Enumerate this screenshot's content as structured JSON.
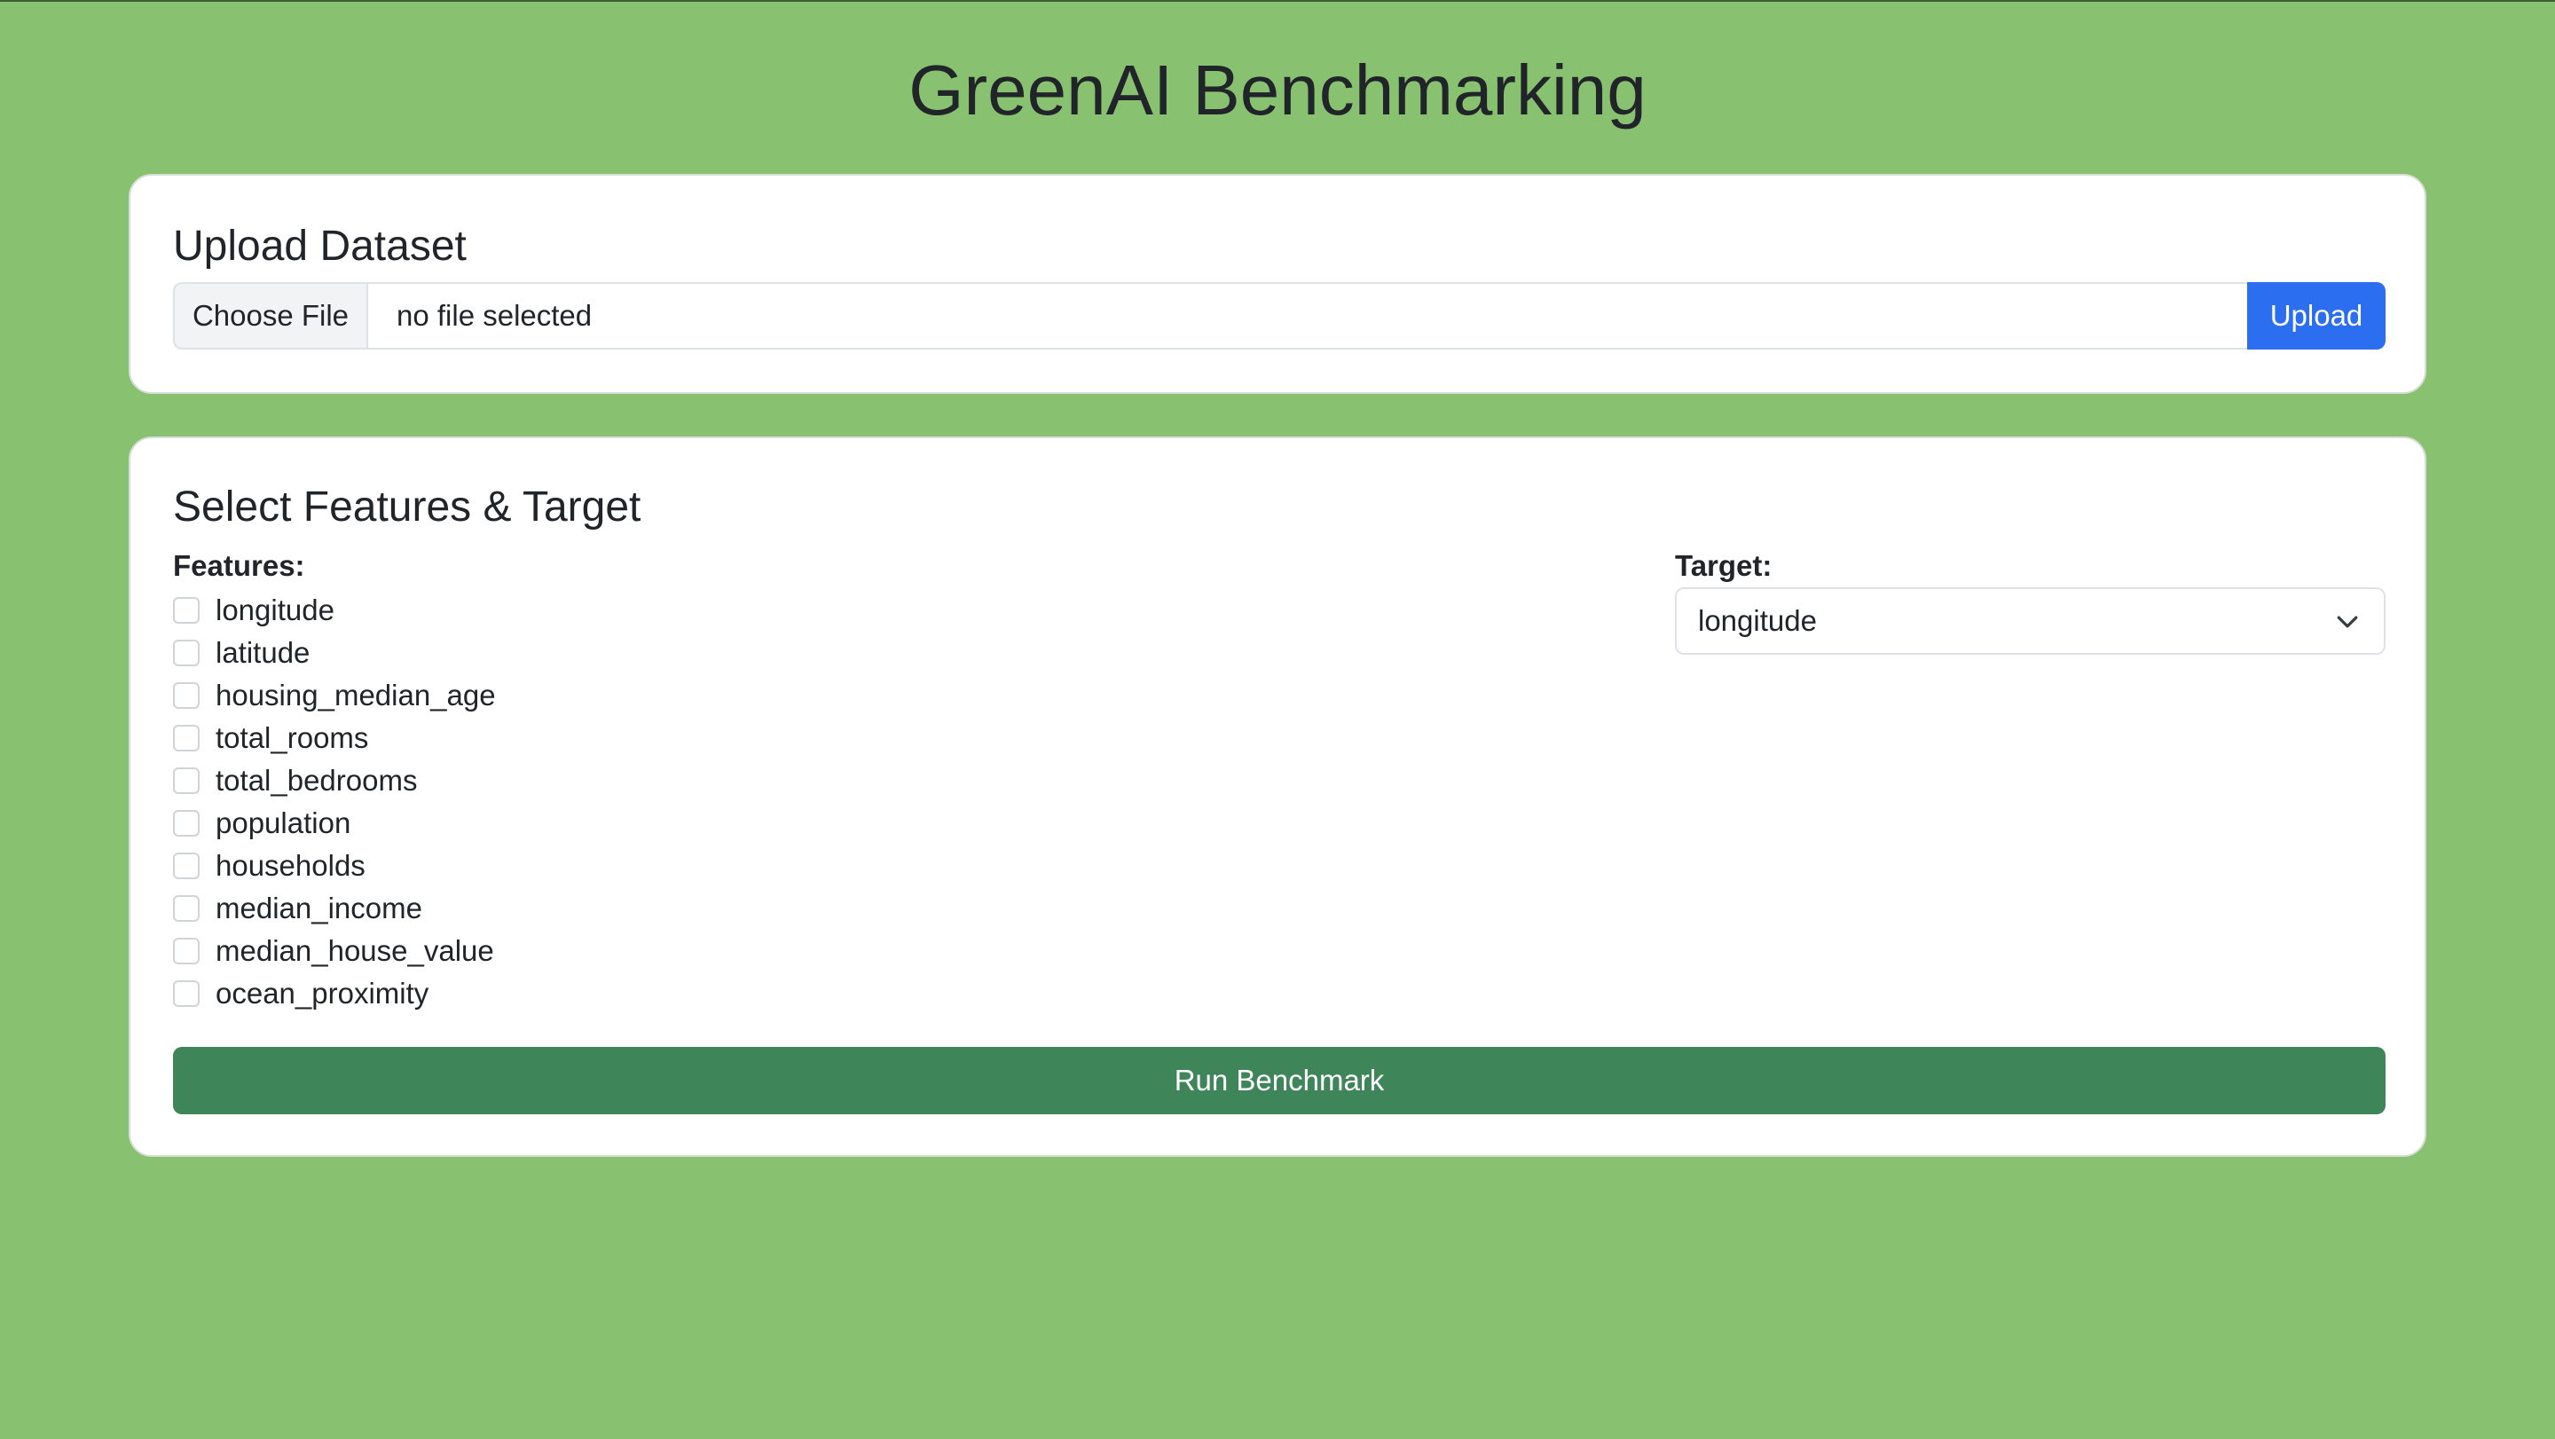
{
  "page": {
    "title": "GreenAI Benchmarking",
    "background_color": "#88c270"
  },
  "upload": {
    "title": "Upload Dataset",
    "choose_file_label": "Choose File",
    "file_status": "no file selected",
    "upload_label": "Upload",
    "upload_color": "#2b6ff0"
  },
  "selection": {
    "title": "Select Features & Target",
    "features_label": "Features:",
    "target_label": "Target:",
    "features": [
      {
        "label": "longitude",
        "checked": false
      },
      {
        "label": "latitude",
        "checked": false
      },
      {
        "label": "housing_median_age",
        "checked": false
      },
      {
        "label": "total_rooms",
        "checked": false
      },
      {
        "label": "total_bedrooms",
        "checked": false
      },
      {
        "label": "population",
        "checked": false
      },
      {
        "label": "households",
        "checked": false
      },
      {
        "label": "median_income",
        "checked": false
      },
      {
        "label": "median_house_value",
        "checked": false
      },
      {
        "label": "ocean_proximity",
        "checked": false
      }
    ],
    "target_value": "longitude",
    "target_icon": "chevron-down-icon",
    "run_label": "Run Benchmark",
    "run_color": "#3f855a"
  }
}
